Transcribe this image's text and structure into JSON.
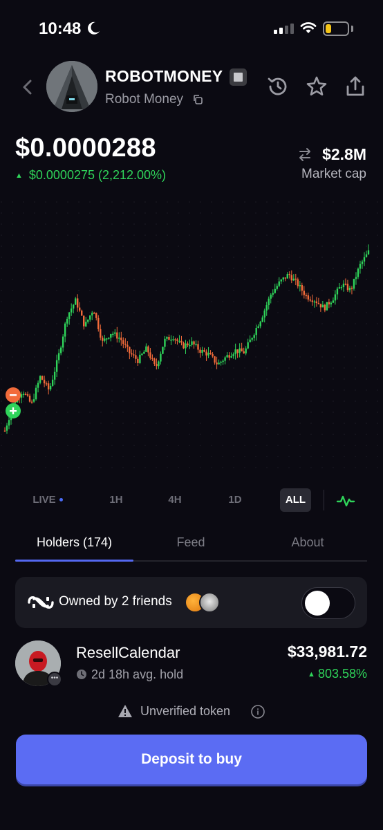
{
  "status_bar": {
    "time": "10:48",
    "moon_icon": "moon-icon",
    "battery_color": "#f5c518"
  },
  "header": {
    "token_name": "ROBOTMONEY",
    "token_subtitle": "Robot Money",
    "icons": [
      "back-chevron-icon",
      "history-icon",
      "star-icon",
      "share-icon",
      "copy-icon"
    ]
  },
  "price": {
    "current": "$0.0000288",
    "change": "$0.0000275 (2,212.00%)",
    "market_cap": "$2.8M",
    "market_cap_label": "Market cap",
    "up_color": "#2fd45a",
    "down_color": "#f26b3a"
  },
  "chart_data": {
    "type": "candlestick",
    "trend": [
      0.06,
      0.2,
      0.26,
      0.19,
      0.33,
      0.26,
      0.42,
      0.63,
      0.71,
      0.58,
      0.67,
      0.5,
      0.55,
      0.52,
      0.45,
      0.41,
      0.47,
      0.37,
      0.51,
      0.53,
      0.48,
      0.5,
      0.46,
      0.44,
      0.39,
      0.43,
      0.46,
      0.45,
      0.54,
      0.63,
      0.74,
      0.8,
      0.84,
      0.79,
      0.73,
      0.71,
      0.67,
      0.72,
      0.79,
      0.76,
      0.88,
      0.95
    ]
  },
  "timeframes": {
    "live": "LIVE",
    "h1": "1H",
    "h4": "4H",
    "d1": "1D",
    "all": "ALL",
    "selected": "ALL"
  },
  "tabs": [
    {
      "label": "Holders (174)",
      "active": true
    },
    {
      "label": "Feed",
      "active": false
    },
    {
      "label": "About",
      "active": false
    }
  ],
  "friends": {
    "text": "Owned by 2 friends",
    "toggle_on": false
  },
  "holder": {
    "name": "ResellCalendar",
    "hold": "2d 18h avg. hold",
    "value": "$33,981.72",
    "pct": "803.58%"
  },
  "notice": {
    "text": "Unverified token"
  },
  "cta": {
    "label": "Deposit to buy",
    "color": "#5b6cf3"
  }
}
